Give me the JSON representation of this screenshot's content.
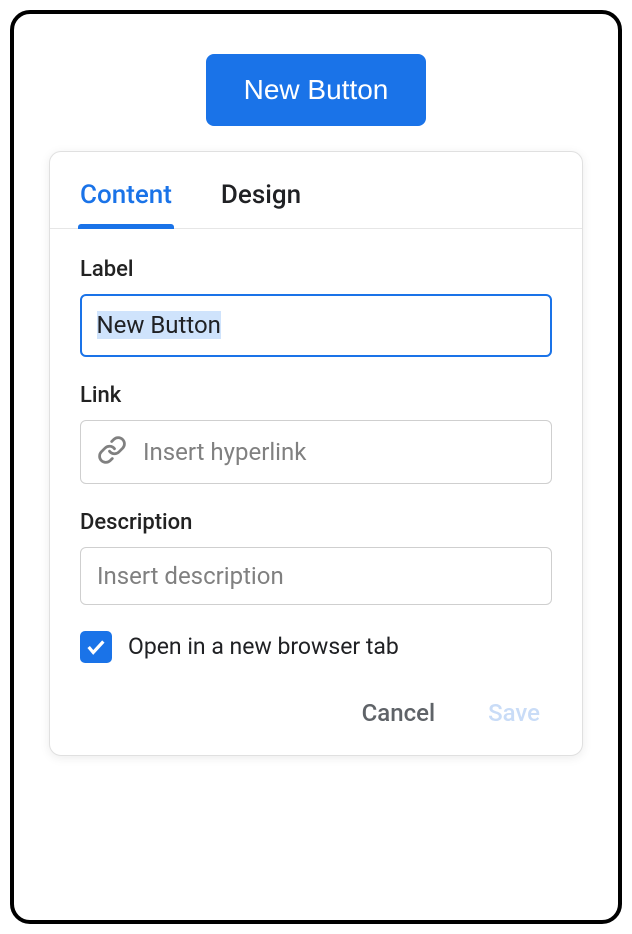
{
  "preview": {
    "button_label": "New Button"
  },
  "tabs": {
    "content": "Content",
    "design": "Design",
    "active": "content"
  },
  "form": {
    "label": {
      "title": "Label",
      "value": "New Button"
    },
    "link": {
      "title": "Link",
      "placeholder": "Insert hyperlink",
      "value": ""
    },
    "description": {
      "title": "Description",
      "placeholder": "Insert description",
      "value": ""
    },
    "open_new_tab": {
      "label": "Open in a new browser tab",
      "checked": true
    }
  },
  "footer": {
    "cancel": "Cancel",
    "save": "Save"
  }
}
